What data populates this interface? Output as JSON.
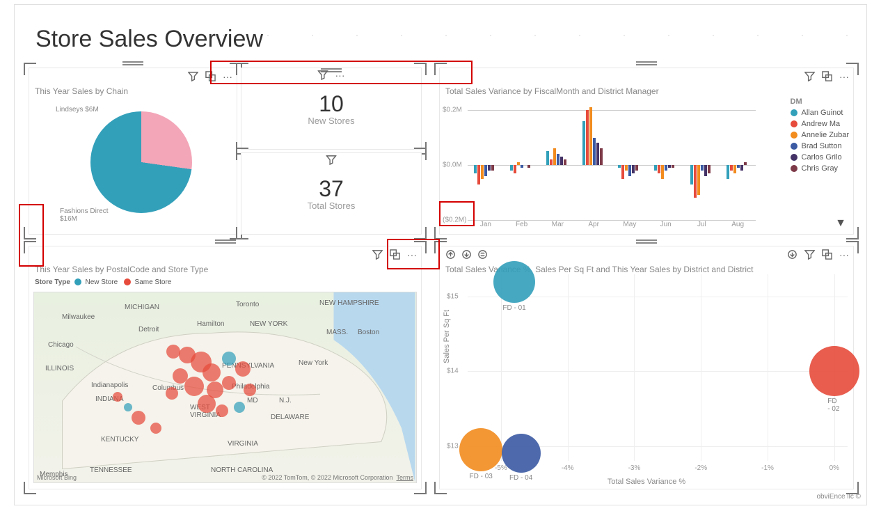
{
  "page": {
    "title": "Store Sales Overview",
    "attribution": "obviEnce llc ©"
  },
  "pie": {
    "title": "This Year Sales by Chain",
    "slices": [
      {
        "label": "Lindseys",
        "value": "$6M",
        "color": "#f3a6b8"
      },
      {
        "label": "Fashions Direct",
        "value": "$16M",
        "color": "#33a0ba"
      }
    ]
  },
  "cards": {
    "new_stores": {
      "value": "10",
      "label": "New Stores"
    },
    "total_stores": {
      "value": "37",
      "label": "Total Stores"
    }
  },
  "variance": {
    "title": "Total Sales Variance by FiscalMonth and District Manager",
    "legend_title": "DM",
    "legend": [
      {
        "name": "Allan Guinot",
        "color": "#33a0ba"
      },
      {
        "name": "Andrew Ma",
        "color": "#e64b3b"
      },
      {
        "name": "Annelie Zubar",
        "color": "#f28c1f"
      },
      {
        "name": "Brad Sutton",
        "color": "#3b5aa3"
      },
      {
        "name": "Carlos Grilo",
        "color": "#443366"
      },
      {
        "name": "Chris Gray",
        "color": "#7d3a48"
      }
    ],
    "y_ticks": [
      "$0.2M",
      "$0.0M",
      "($0.2M)"
    ],
    "months": [
      "Jan",
      "Feb",
      "Mar",
      "Apr",
      "May",
      "Jun",
      "Jul",
      "Aug"
    ],
    "chart_data": {
      "type": "bar",
      "ylim": [
        -0.2,
        0.2
      ],
      "categories": [
        "Jan",
        "Feb",
        "Mar",
        "Apr",
        "May",
        "Jun",
        "Jul",
        "Aug"
      ],
      "series": [
        {
          "name": "Allan Guinot",
          "color": "#33a0ba",
          "values": [
            -0.03,
            -0.02,
            0.05,
            0.16,
            -0.01,
            -0.02,
            -0.07,
            -0.05
          ]
        },
        {
          "name": "Andrew Ma",
          "color": "#e64b3b",
          "values": [
            -0.07,
            -0.03,
            0.02,
            0.2,
            -0.05,
            -0.03,
            -0.12,
            -0.02
          ]
        },
        {
          "name": "Annelie Zubar",
          "color": "#f28c1f",
          "values": [
            -0.05,
            0.01,
            0.06,
            0.21,
            -0.02,
            -0.05,
            -0.11,
            -0.03
          ]
        },
        {
          "name": "Brad Sutton",
          "color": "#3b5aa3",
          "values": [
            -0.04,
            -0.01,
            0.04,
            0.1,
            -0.04,
            -0.02,
            -0.02,
            -0.01
          ]
        },
        {
          "name": "Carlos Grilo",
          "color": "#443366",
          "values": [
            -0.02,
            0.0,
            0.03,
            0.08,
            -0.03,
            -0.01,
            -0.04,
            -0.02
          ]
        },
        {
          "name": "Chris Gray",
          "color": "#7d3a48",
          "values": [
            -0.02,
            -0.01,
            0.02,
            0.06,
            -0.02,
            -0.01,
            -0.03,
            0.01
          ]
        }
      ]
    }
  },
  "map": {
    "title": "This Year Sales by PostalCode and Store Type",
    "legend_title": "Store Type",
    "legend": [
      {
        "name": "New Store",
        "color": "#33a0ba"
      },
      {
        "name": "Same Store",
        "color": "#e64b3b"
      }
    ],
    "credits_left": "Microsoft Bing",
    "credits_right": "© 2022 TomTom, © 2022 Microsoft Corporation",
    "terms": "Terms"
  },
  "scatter": {
    "title": "Total Sales Variance %, Sales Per Sq Ft and This Year Sales by District and District",
    "xlabel": "Total Sales Variance %",
    "ylabel": "Sales Per Sq Ft",
    "x_ticks": [
      "-5%",
      "-4%",
      "-3%",
      "-2%",
      "-1%",
      "0%"
    ],
    "y_ticks": [
      "$13",
      "$14",
      "$15"
    ],
    "chart_data": {
      "type": "scatter",
      "xlim": [
        -5.5,
        0.2
      ],
      "ylim": [
        12.8,
        15.3
      ],
      "points": [
        {
          "label": "FD - 01",
          "x": -4.8,
          "y": 15.2,
          "size": 60,
          "color": "#33a0ba"
        },
        {
          "label": "FD - 02",
          "x": 0.0,
          "y": 14.0,
          "size": 72,
          "color": "#e64b3b"
        },
        {
          "label": "FD - 03",
          "x": -5.3,
          "y": 12.95,
          "size": 62,
          "color": "#f28c1f"
        },
        {
          "label": "FD - 04",
          "x": -4.7,
          "y": 12.9,
          "size": 56,
          "color": "#3b5aa3"
        }
      ]
    }
  }
}
